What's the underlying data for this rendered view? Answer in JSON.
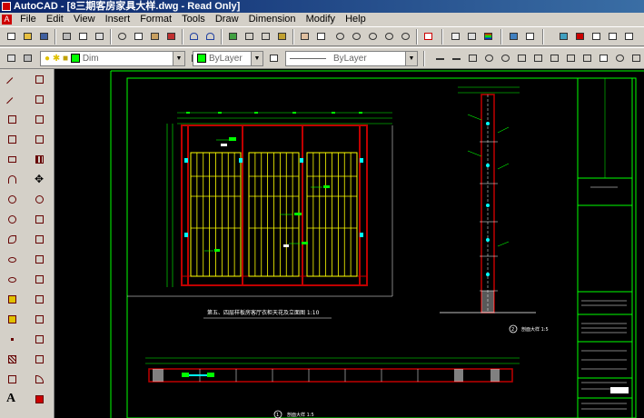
{
  "window": {
    "title": "AutoCAD - [8三期客房家具大样.dwg - Read Only]"
  },
  "menu": {
    "items": [
      "File",
      "Edit",
      "View",
      "Insert",
      "Format",
      "Tools",
      "Draw",
      "Dimension",
      "Modify",
      "Help"
    ]
  },
  "layer_toolbar": {
    "layer_name": "Dim",
    "color_value": "ByLayer",
    "linetype_value": "ByLayer"
  },
  "drawing": {
    "elevation_caption": "第五、四层样板房客厅衣柜天花及立面图 1:10",
    "section_caption": "剖面大样 1:5",
    "plan_caption": "剖面大样 1:5",
    "section_label_num": "2",
    "plan_label_num": "1"
  },
  "colors": {
    "titlebar_start": "#0a246a",
    "canvas_bg": "#000000",
    "frame_line": "#00ff00",
    "wood_line": "#c00000",
    "glass_grid": "#ffff00",
    "dimension": "#00ff00",
    "annotation": "#ffffff",
    "hardware": "#00ffff"
  }
}
